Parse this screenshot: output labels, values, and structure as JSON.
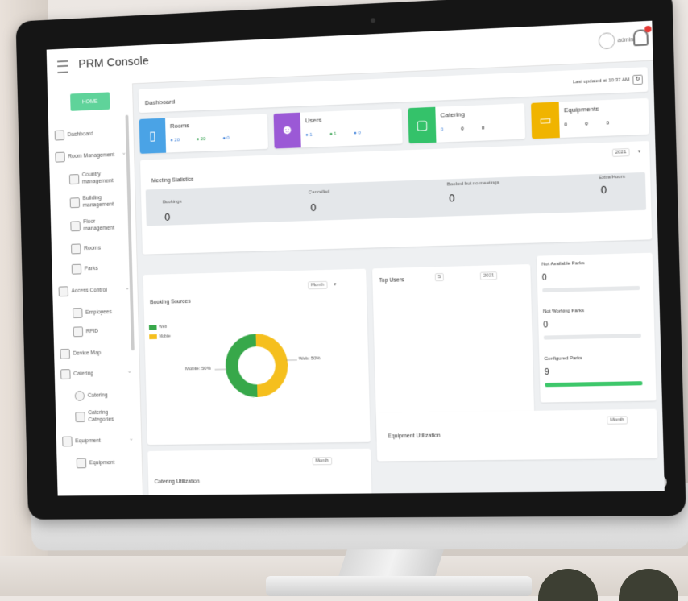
{
  "app": {
    "title": "PRM Console",
    "user_name": "admin"
  },
  "sidebar": {
    "home_label": "HOME",
    "items": [
      {
        "label": "Dashboard"
      },
      {
        "label": "Room Management"
      },
      {
        "label": "Country management"
      },
      {
        "label": "Building management"
      },
      {
        "label": "Floor management"
      },
      {
        "label": "Rooms"
      },
      {
        "label": "Parks"
      },
      {
        "label": "Access Control"
      },
      {
        "label": "Employees"
      },
      {
        "label": "RFID"
      },
      {
        "label": "Device Map"
      },
      {
        "label": "Catering"
      },
      {
        "label": "Catering"
      },
      {
        "label": "Catering Categories"
      },
      {
        "label": "Equipment"
      },
      {
        "label": "Equipment"
      }
    ]
  },
  "header": {
    "title": "Dashboard",
    "last_updated": "Last updated at 10:37 AM"
  },
  "stats": [
    {
      "label": "Rooms",
      "color": "#4aa3e6",
      "values": [
        "● 20",
        "● 20",
        "● 0"
      ]
    },
    {
      "label": "Users",
      "color": "#9b59d6",
      "values": [
        "● 1",
        "● 1",
        "● 0"
      ]
    },
    {
      "label": "Catering",
      "color": "#34c26a",
      "values": [
        "0",
        "0",
        "0"
      ]
    },
    {
      "label": "Equipments",
      "color": "#f0b400",
      "values": [
        "0",
        "0",
        "0"
      ]
    }
  ],
  "meeting": {
    "title": "Meeting Statistics",
    "period": "2021",
    "items": [
      {
        "label": "Bookings",
        "value": "0"
      },
      {
        "label": "Cancelled",
        "value": "0"
      },
      {
        "label": "Booked but no meetings",
        "value": "0"
      },
      {
        "label": "Extra Hours",
        "value": "0"
      }
    ]
  },
  "booking_sources": {
    "title": "Booking Sources",
    "period": "Month",
    "legend": [
      {
        "label": "Web",
        "color": "#37a84a"
      },
      {
        "label": "Mobile",
        "color": "#f5bf1d"
      }
    ],
    "slices": [
      {
        "label": "Mobile: 50%",
        "value": 50
      },
      {
        "label": "Web: 50%",
        "value": 50
      }
    ]
  },
  "top_users": {
    "title": "Top Users",
    "filter1": "5",
    "filter2": "2021"
  },
  "side_stats": [
    {
      "label": "Not Available Parks",
      "value": "0",
      "fill": 0
    },
    {
      "label": "Not Working Parks",
      "value": "0",
      "fill": 0
    },
    {
      "label": "Configured Parks",
      "value": "9",
      "fill": 1
    }
  ],
  "catering_util": {
    "title": "Catering Utilization",
    "period": "Month"
  },
  "equipment_util": {
    "title": "Equipment Utilization",
    "period": "Month"
  }
}
